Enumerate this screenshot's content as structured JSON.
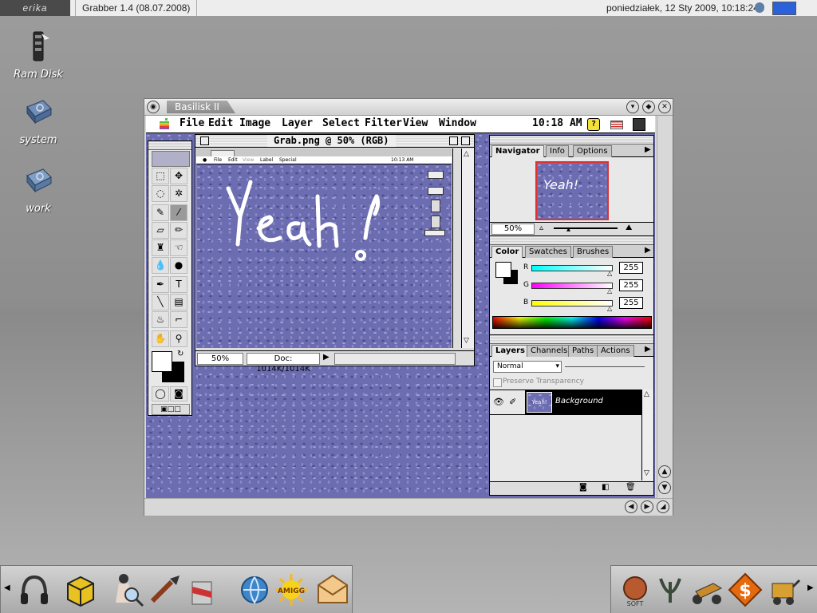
{
  "topbar": {
    "logo": "erika",
    "app_title": "Grabber 1.4 (08.07.2008)",
    "datetime": "poniedziałek, 12 Sty 2009, 10:18:24"
  },
  "desktop_icons": [
    {
      "label": "Ram Disk"
    },
    {
      "label": "system"
    },
    {
      "label": "work"
    }
  ],
  "basilisk": {
    "title": "Basilisk II",
    "menu": [
      "File",
      "Edit",
      "Image",
      "Layer",
      "Select",
      "Filter",
      "View",
      "Window"
    ],
    "clock": "10:18 AM",
    "doc_window": {
      "title": "Grab.png @ 50% (RGB)",
      "zoom": "50%",
      "doc_info": "Doc: 1014K/1014K",
      "canvas_text": "Yeah!",
      "inner_menu": [
        "File",
        "Edit",
        "View",
        "Label",
        "Special"
      ],
      "inner_clock": "10:13 AM"
    },
    "navigator": {
      "tabs": [
        "Navigator",
        "Info",
        "Options"
      ],
      "zoom": "50%",
      "preview_text": "Yeah!"
    },
    "color": {
      "tabs": [
        "Color",
        "Swatches",
        "Brushes"
      ],
      "channels": [
        {
          "name": "R",
          "value": "255",
          "color": "#00d7d7"
        },
        {
          "name": "G",
          "value": "255",
          "color": "#d700d7"
        },
        {
          "name": "B",
          "value": "255",
          "color": "#d7d700"
        }
      ]
    },
    "layers": {
      "tabs": [
        "Layers",
        "Channels",
        "Paths",
        "Actions"
      ],
      "blend_mode": "Normal",
      "preserve_label": "Preserve Transparency",
      "layer_name": "Background",
      "thumb_text": "Yeah!"
    }
  }
}
